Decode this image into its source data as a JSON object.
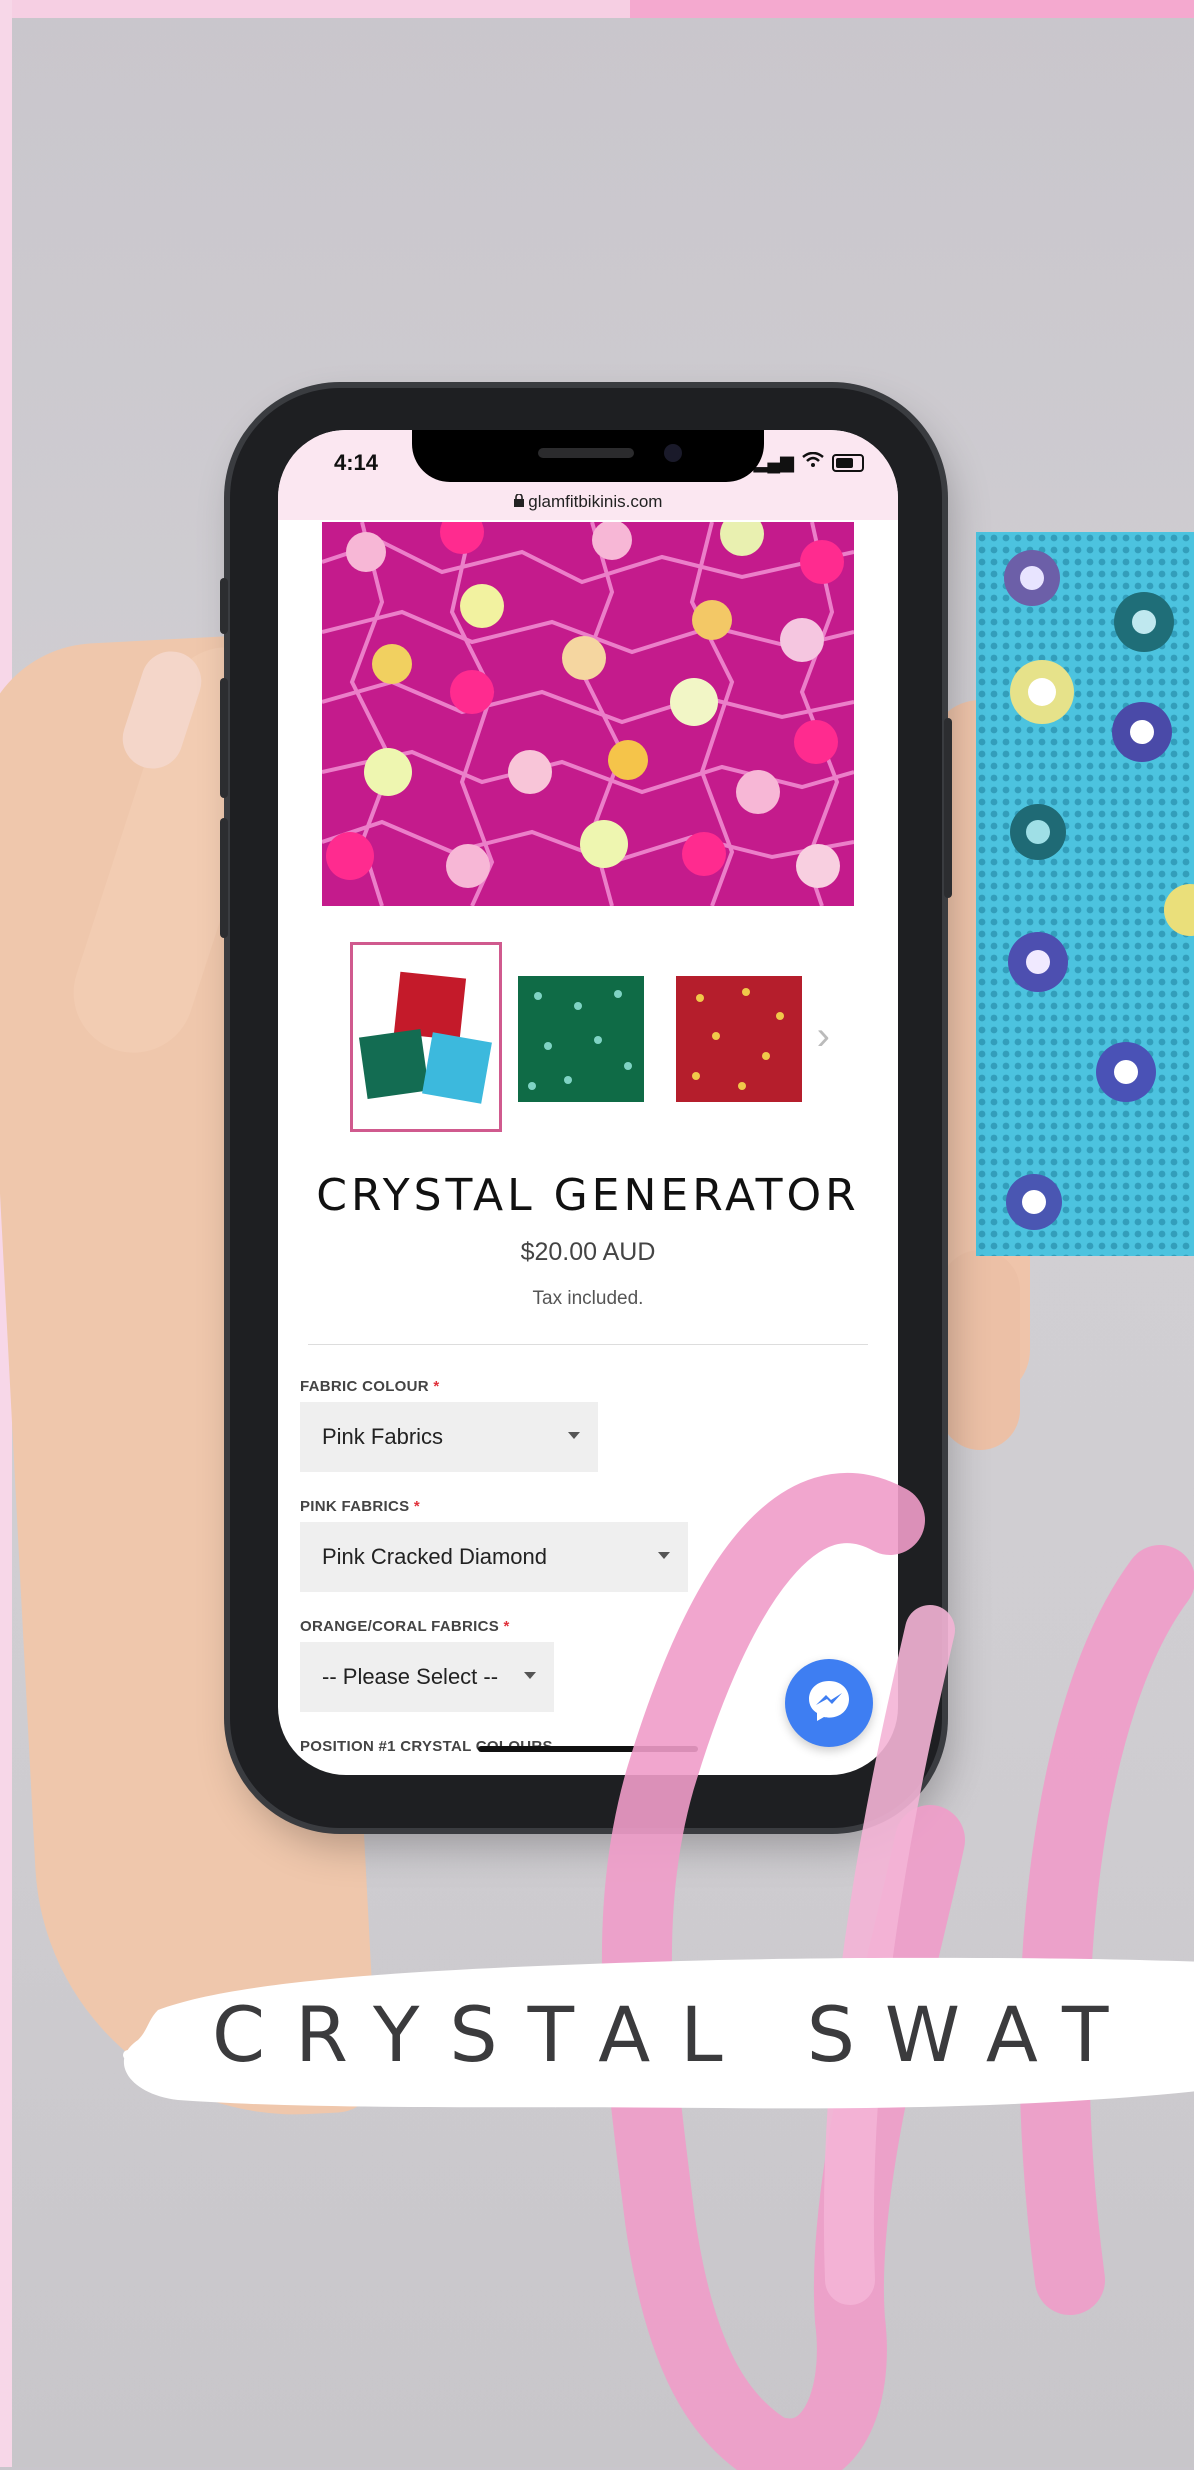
{
  "status_bar": {
    "time": "4:14",
    "url": "glamfitbikinis.com"
  },
  "product": {
    "title": "CRYSTAL GENERATOR",
    "price": "$20.00 AUD",
    "tax_note": "Tax included."
  },
  "options": [
    {
      "label": "FABRIC COLOUR",
      "required": "*",
      "value": "Pink Fabrics"
    },
    {
      "label": "PINK FABRICS",
      "required": "*",
      "value": "Pink Cracked Diamond"
    },
    {
      "label": "ORANGE/CORAL FABRICS",
      "required": "*",
      "value": "-- Please Select --"
    },
    {
      "label": "POSITION #1 CRYSTAL COLOURS"
    }
  ],
  "banner": {
    "text": "CRYSTAL SWAT"
  },
  "colors": {
    "accent_pink": "#d05a8e",
    "hero_magenta": "#d9279a",
    "messenger_blue": "#3e7ef2",
    "swatch_cyan": "#39b7d6"
  },
  "icons": [
    "lock-icon",
    "signal-icon",
    "wifi-icon",
    "battery-icon",
    "chevron-right-icon",
    "caret-down-icon",
    "messenger-icon"
  ]
}
